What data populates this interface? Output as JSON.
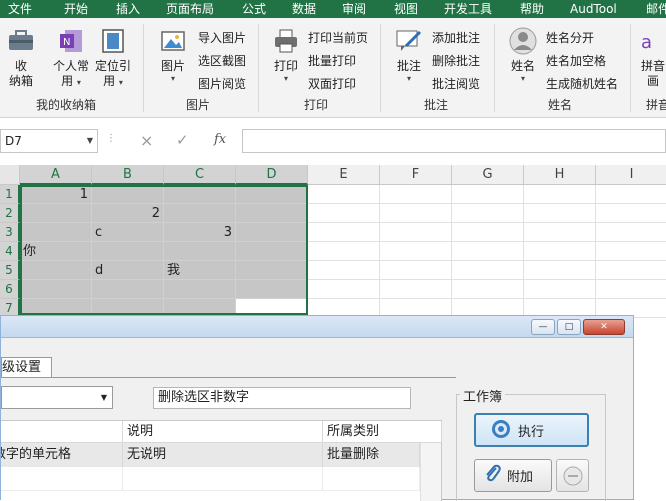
{
  "ribbon_tabs": [
    "文件",
    "开始",
    "插入",
    "页面布局",
    "公式",
    "数据",
    "审阅",
    "视图",
    "开发工具",
    "帮助",
    "AudTool",
    "邮件"
  ],
  "groups": {
    "toolbox": {
      "label": "我的收纳箱",
      "btn_box_line1": "收",
      "btn_box_line2": "纳箱",
      "btn_personal_line1": "个人常",
      "btn_personal_line2": "用",
      "btn_locate_line1": "定位引",
      "btn_locate_line2": "用"
    },
    "picture": {
      "label": "图片",
      "btn_picture": "图片",
      "items": [
        "导入图片",
        "选区截图",
        "图片阅览"
      ]
    },
    "print": {
      "label": "打印",
      "btn_print": "打印",
      "items": [
        "打印当前页",
        "批量打印",
        "双面打印"
      ]
    },
    "comment": {
      "label": "批注",
      "btn_comment": "批注",
      "items": [
        "添加批注",
        "删除批注",
        "批注阅览"
      ]
    },
    "name": {
      "label": "姓名",
      "btn_name": "姓名",
      "items": [
        "姓名分开",
        "姓名加空格",
        "生成随机姓名"
      ]
    },
    "pinyin": {
      "label": "拼音",
      "btn_line1": "拼音",
      "btn_line2": "画"
    }
  },
  "formula_bar": {
    "name_box": "D7",
    "cancel_icon": "×",
    "enter_icon": "✓",
    "fx": "fx",
    "formula": ""
  },
  "sheet": {
    "columns": [
      "A",
      "B",
      "C",
      "D",
      "E",
      "F",
      "G",
      "H",
      "I"
    ],
    "rows": [
      "1",
      "2",
      "3",
      "4",
      "5",
      "6",
      "7"
    ],
    "cells": {
      "A1": "1",
      "B2": "2",
      "B3": "c",
      "C3": "3",
      "A4": "你",
      "B5": "d",
      "C5": "我"
    }
  },
  "dialog": {
    "tab_label": "高级设置",
    "description": "删除选区非数字",
    "list_headers": [
      "数字的单元格",
      "说明",
      "所属类别"
    ],
    "list_header_first_visible": "",
    "list_row": {
      "name": "数字的单元格",
      "desc": "无说明",
      "category": "批量删除"
    },
    "group_title": "工作簿",
    "run_button": "执行",
    "add_button": "附加",
    "winbtns": {
      "minimize": "—",
      "maximize": "□",
      "close": "✕"
    }
  },
  "colors": {
    "excel_green": "#217346",
    "selection_fill": "#c6c6c6",
    "dialog_bg": "#f0f0f0"
  }
}
